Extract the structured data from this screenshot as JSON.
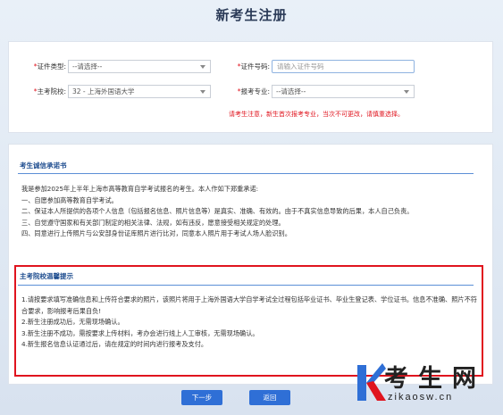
{
  "page": {
    "title": "新考生注册"
  },
  "form": {
    "cert_type": {
      "label": "证件类型:",
      "value": "--请选择--"
    },
    "cert_number": {
      "label": "证件号码:",
      "placeholder": "请输入证件号码"
    },
    "school": {
      "label": "主考院校:",
      "value": "32 - 上海外国语大学"
    },
    "major": {
      "label": "报考专业:",
      "value": "--请选择--"
    },
    "notice": "请考生注意，新生首次报考专业，当次不可更改，请慎重选择。"
  },
  "commitment": {
    "title": "考生诚信承诺书",
    "paragraphs": [
      "我是参加2025年上半年上海市高等教育自学考试报名的考生。本人作如下郑重承诺:",
      "一、自愿参加高等教育自学考试。",
      "二、保证本人所提供的各项个人信息（包括报名信息、照片信息等）是真实、准确、有效的。由于不真实信息导致的后果，本人自己负责。",
      "三、自觉遵守国家和有关部门制定的相关法律、法规，如有违反，愿意接受相关规定的处理。",
      "四、同意进行上传照片与公安部身份证库照片进行比对，同意本人照片用于考试人场人脸识别。"
    ]
  },
  "school_notice": {
    "title": "主考院校温馨提示",
    "paragraphs": [
      "1.请按要求填写准确信息和上传符合要求的照片，该照片将用于上海外国语大学自学考试全过程包括毕业证书、毕业生登记表、学位证书。信息不准确、照片不符合要求，影响报考后果自负!",
      "2.新生注册成功后，无需现场确认。",
      "3.新生注册不成功，需按要求上传材料，考办会进行线上人工审核，无需现场确认。",
      "4.新生报名信息认证通过后，请在规定的时间内进行报考及支付。"
    ]
  },
  "buttons": {
    "next": "下一步",
    "back": "返回"
  },
  "watermark": {
    "text": "考生网",
    "url": "zikaosw.cn"
  },
  "colors": {
    "primary": "#2f6fd6",
    "required": "#e0141e",
    "section_title": "#1c4b8e",
    "highlight_border": "#e0141e"
  }
}
